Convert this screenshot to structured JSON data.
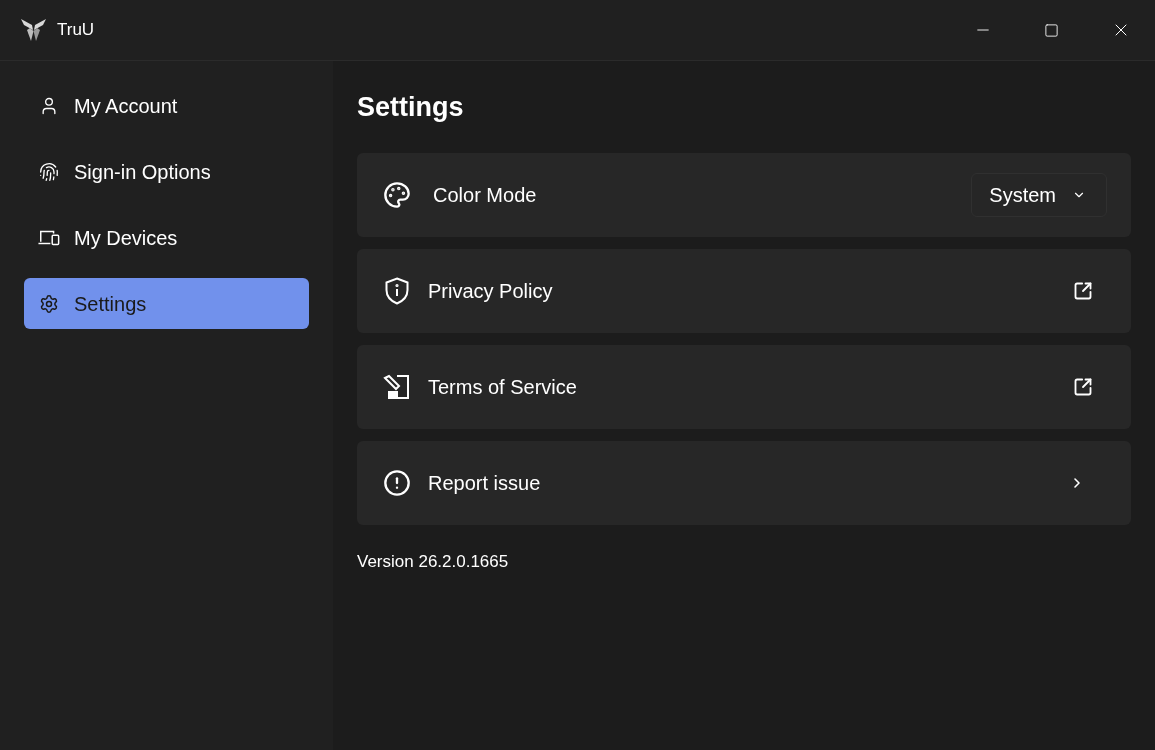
{
  "window": {
    "title": "TruU"
  },
  "sidebar": {
    "items": [
      {
        "label": "My Account",
        "selected": false
      },
      {
        "label": "Sign-in Options",
        "selected": false
      },
      {
        "label": "My Devices",
        "selected": false
      },
      {
        "label": "Settings",
        "selected": true
      }
    ]
  },
  "page": {
    "title": "Settings",
    "rows": [
      {
        "kind": "dropdown",
        "label": "Color Mode",
        "value": "System"
      },
      {
        "kind": "external_link",
        "label": "Privacy Policy"
      },
      {
        "kind": "external_link",
        "label": "Terms of Service"
      },
      {
        "kind": "navigation",
        "label": "Report issue"
      }
    ],
    "version": "Version 26.2.0.1665"
  }
}
